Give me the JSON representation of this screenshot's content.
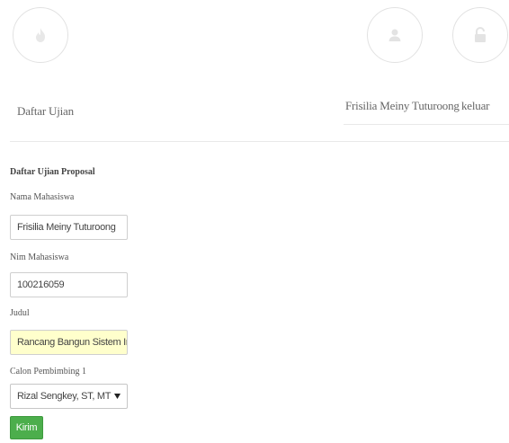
{
  "nav": {
    "items": [
      {
        "label": "Daftar Ujian",
        "icon": "fire-icon"
      },
      {
        "label": "Frisilia Meiny Tuturoong",
        "icon": "user-icon"
      },
      {
        "label": "keluar",
        "icon": "unlock-icon"
      }
    ]
  },
  "form": {
    "title": "Daftar Ujian Proposal",
    "fields": [
      {
        "label": "Nama Mahasiswa",
        "value": "Frisilia Meiny Tuturoong"
      },
      {
        "label": "Nim Mahasiswa",
        "value": "100216059"
      },
      {
        "label": "Judul",
        "value": "Rancang Bangun Sistem Informa"
      },
      {
        "label": "Calon Pembimbing 1",
        "value": "Rizal Sengkey, ST, MT"
      }
    ],
    "submit_label": "Kirim"
  },
  "colors": {
    "highlight_field": "#ffffcc",
    "submit_button": "#4cae4c"
  }
}
